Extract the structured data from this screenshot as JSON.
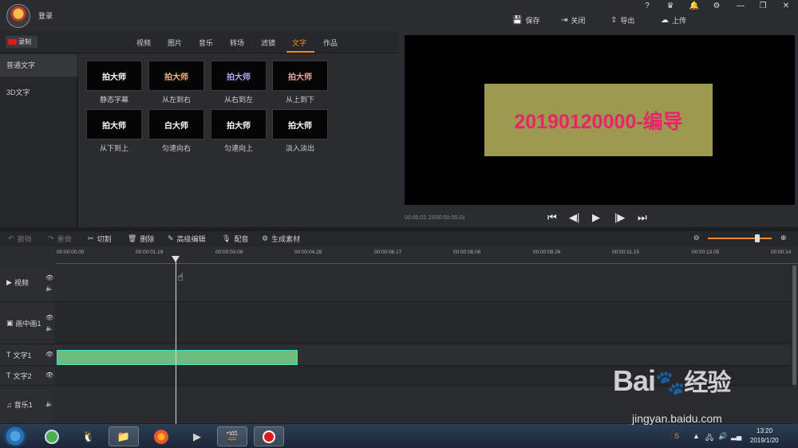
{
  "header": {
    "login": "登录",
    "help_icon": "?",
    "actions": [
      {
        "label": "保存",
        "icon": "save-icon"
      },
      {
        "label": "关闭",
        "icon": "exit-icon"
      },
      {
        "label": "导出",
        "icon": "export-icon"
      },
      {
        "label": "上传",
        "icon": "upload-icon"
      }
    ]
  },
  "record_label": "录制",
  "tabs": [
    "视频",
    "图片",
    "音乐",
    "转场",
    "滤镜",
    "文字",
    "作品"
  ],
  "active_tab": "文字",
  "categories": [
    "普通文字",
    "3D文字"
  ],
  "effects": [
    {
      "preview": "拍大师",
      "label": "静态字幕",
      "color": "#ffffff"
    },
    {
      "preview": "拍大师",
      "label": "从左到右",
      "color": "#f4b183"
    },
    {
      "preview": "拍大师",
      "label": "从右到左",
      "color": "#b4a7f5"
    },
    {
      "preview": "拍大师",
      "label": "从上到下",
      "color": "#f3a0a0"
    },
    {
      "preview": "拍大师",
      "label": "从下到上",
      "color": "#ffffff"
    },
    {
      "preview": "白大师",
      "label": "匀速向右",
      "color": "#ffffff"
    },
    {
      "preview": "拍大师",
      "label": "匀速向上",
      "color": "#ffffff"
    },
    {
      "preview": "拍大师",
      "label": "淡入淡出",
      "color": "#ffffff"
    }
  ],
  "preview": {
    "caption": "20190120000-编导",
    "timecode": "00:00:02.15/00:00:05.01"
  },
  "toolbar": {
    "undo": "撤销",
    "redo": "重做",
    "cut": "切割",
    "delete": "删除",
    "advanced": "高级编辑",
    "dub": "配音",
    "generate": "生成素材"
  },
  "ruler": [
    "00:00:00.00",
    "00:00:01.19",
    "00:00:03.08",
    "00:00:04.28",
    "00:00:06.17",
    "00:00:08.06",
    "00:00:09.26",
    "00:00:11.15",
    "00:00:13.05",
    "00:00:14"
  ],
  "tracks": [
    {
      "label": "视频",
      "icon": "▶"
    },
    {
      "label": "画中画1",
      "icon": "▣"
    },
    {
      "label": "文字1",
      "icon": "T"
    },
    {
      "label": "文字2",
      "icon": "T"
    },
    {
      "label": "音乐1",
      "icon": "♫"
    }
  ],
  "taskbar": {
    "time": "13:20",
    "date": "2019/1/20"
  },
  "watermark": {
    "logo": "Bai",
    "logo_tail": "经验",
    "url": "jingyan.baidu.com"
  },
  "colors": {
    "accent": "#f08a24",
    "caption_bg": "#9c9a4f",
    "caption_text": "#e8246a",
    "clip": "#6fbd7e"
  }
}
